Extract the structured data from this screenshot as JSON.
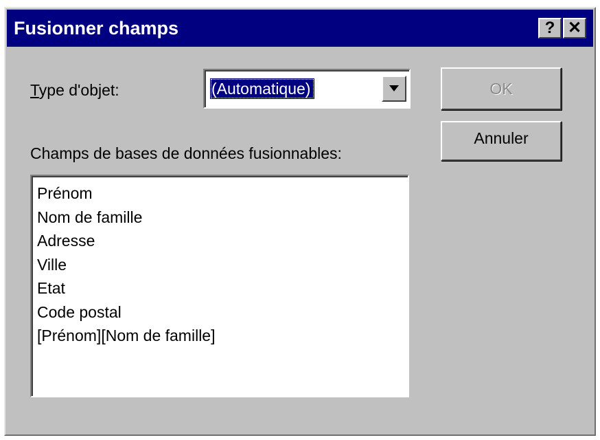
{
  "dialog": {
    "title": "Fusionner champs",
    "help_button": "?",
    "close_button": "✕"
  },
  "type_label": {
    "mnemonic": "T",
    "rest": "ype d'objet:"
  },
  "type_select": {
    "value": "(Automatique)"
  },
  "fields_label": "Champs de bases de données fusionnables:",
  "fields": [
    "Prénom",
    "Nom de famille",
    "Adresse",
    "Ville",
    "Etat",
    "Code postal",
    "[Prénom][Nom de famille]"
  ],
  "buttons": {
    "ok": "OK",
    "ok_enabled": false,
    "cancel": "Annuler"
  },
  "colors": {
    "titlebar": "#000080",
    "dialog_face": "#c0c0c0",
    "selection": "#000080"
  }
}
